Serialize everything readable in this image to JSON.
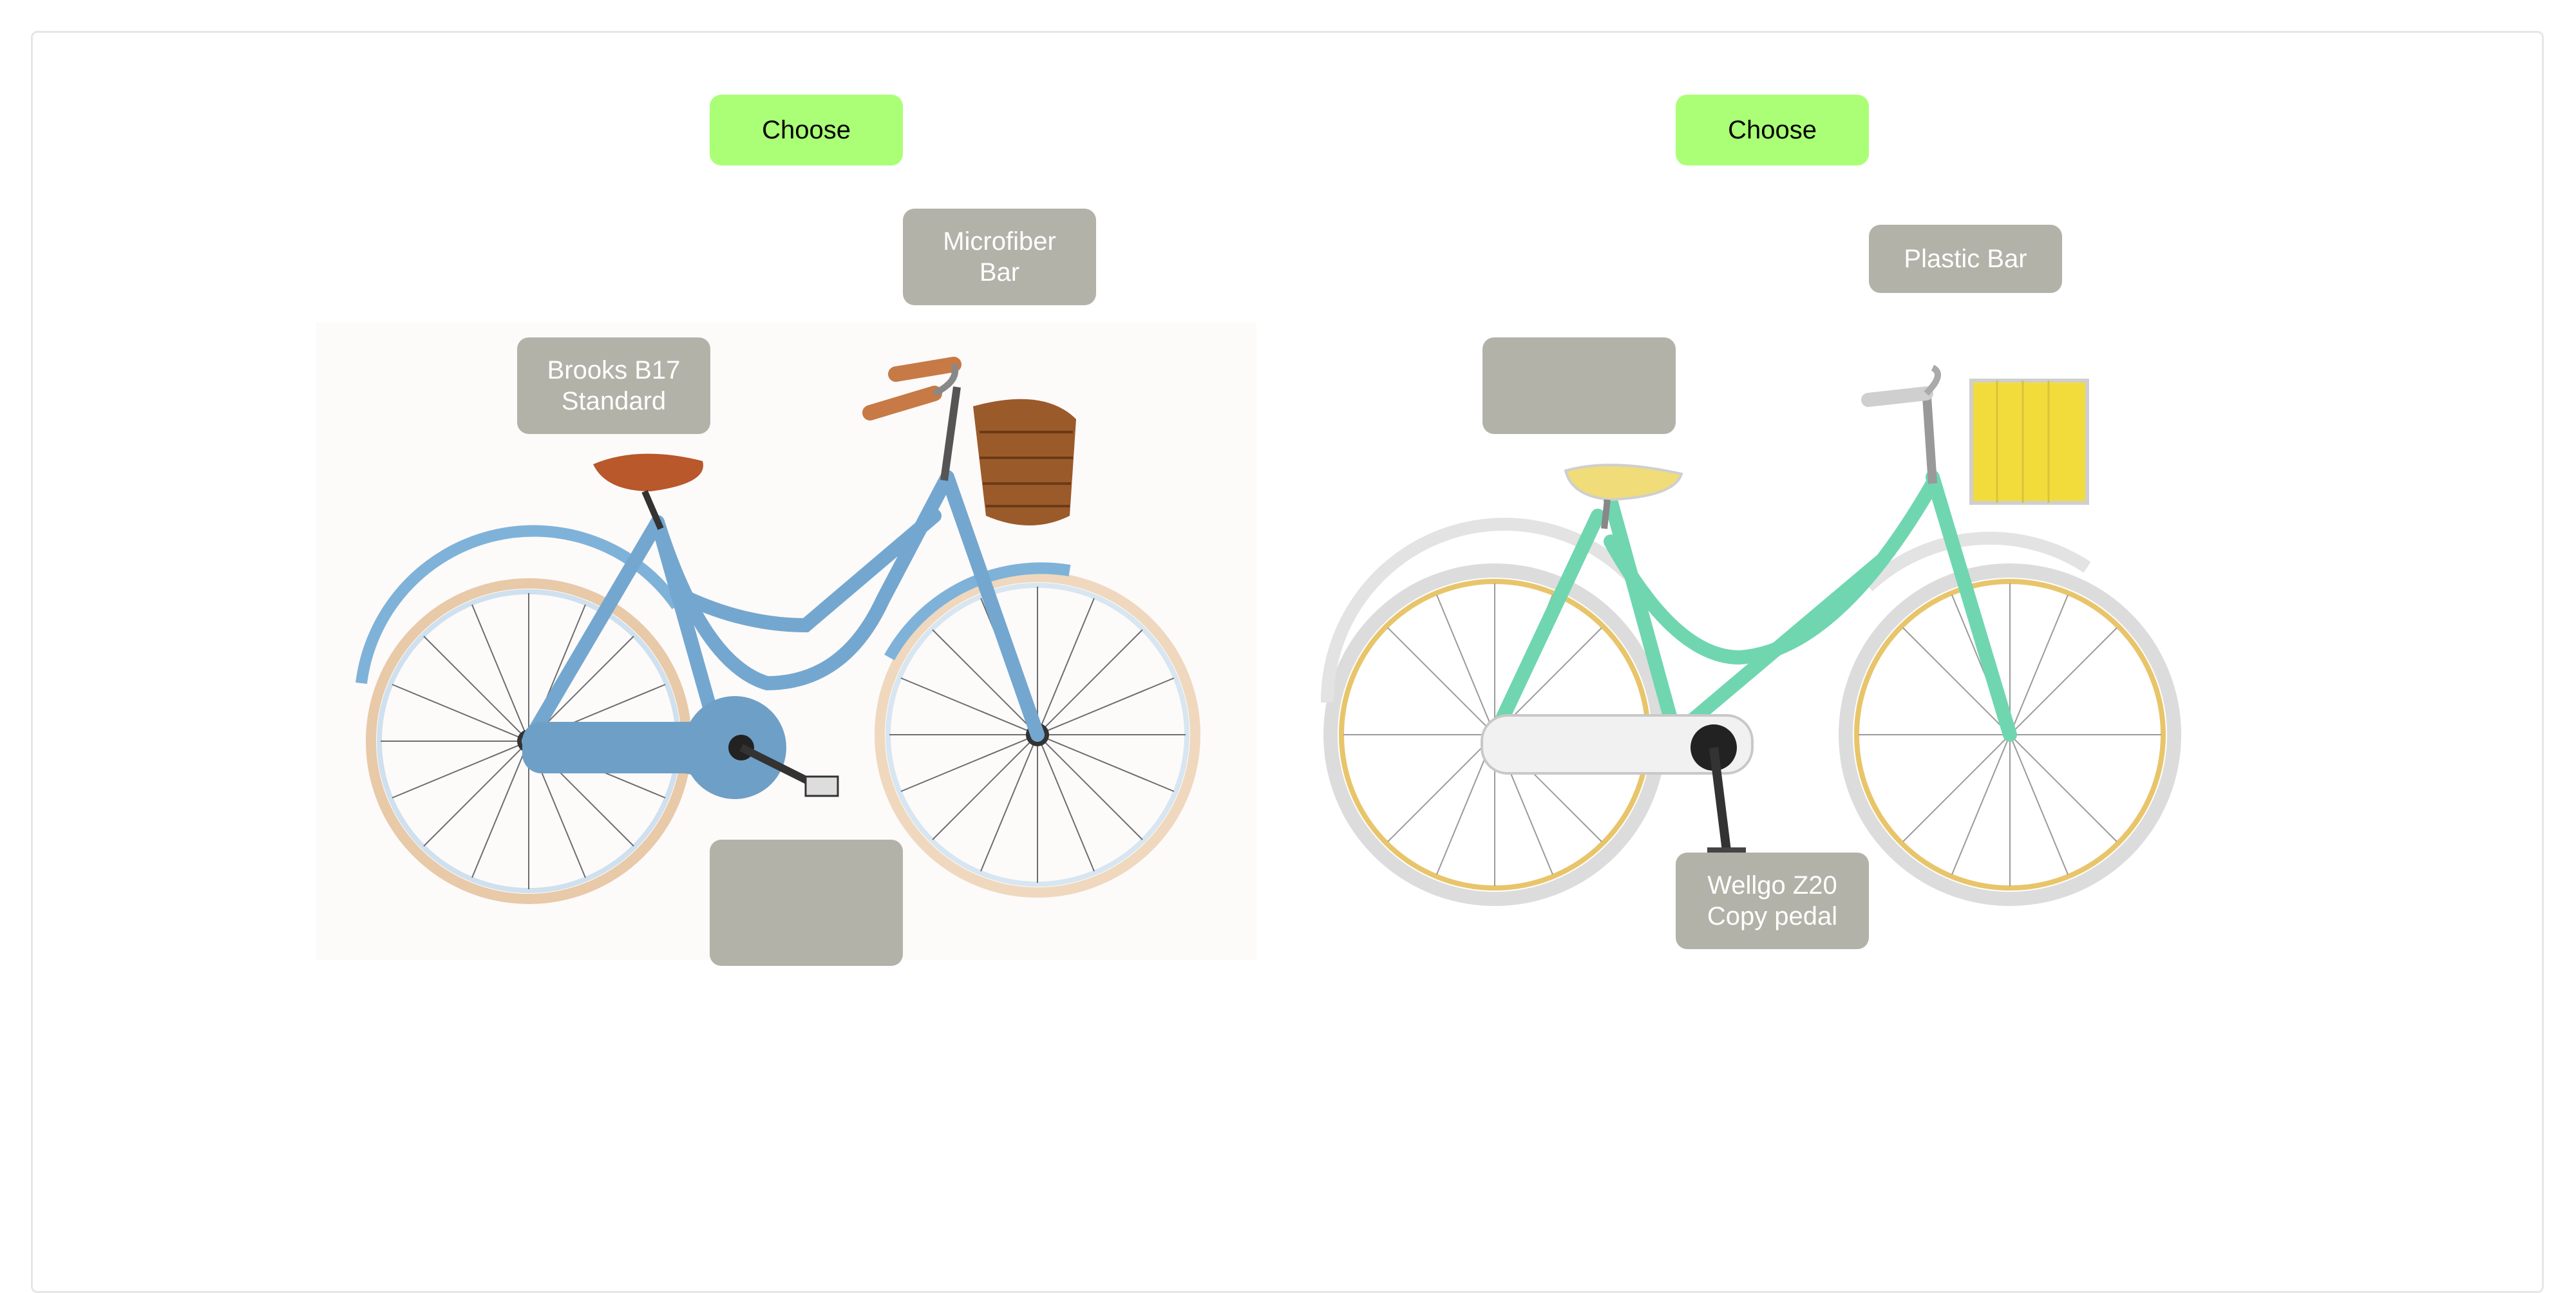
{
  "options": [
    {
      "choose_label": "Choose",
      "bike_name": "blue-city-bike",
      "saddle_label": "Brooks B17\nStandard",
      "handlebar_label": "Microfiber\nBar",
      "pedal_label": ""
    },
    {
      "choose_label": "Choose",
      "bike_name": "mint-cruiser-bike",
      "saddle_label": "",
      "handlebar_label": "Plastic Bar",
      "pedal_label": "Wellgo Z20\nCopy pedal"
    }
  ],
  "colors": {
    "choose_button": "#aaff77",
    "tag_background": "#b2b2a8",
    "bike1_frame": "#74a7cf",
    "bike2_frame": "#6fd6b0",
    "bike1_saddle": "#b8582b",
    "bike2_saddle": "#f0dc78",
    "basket1": "#9b5a2a",
    "basket2": "#f2dc3c"
  }
}
